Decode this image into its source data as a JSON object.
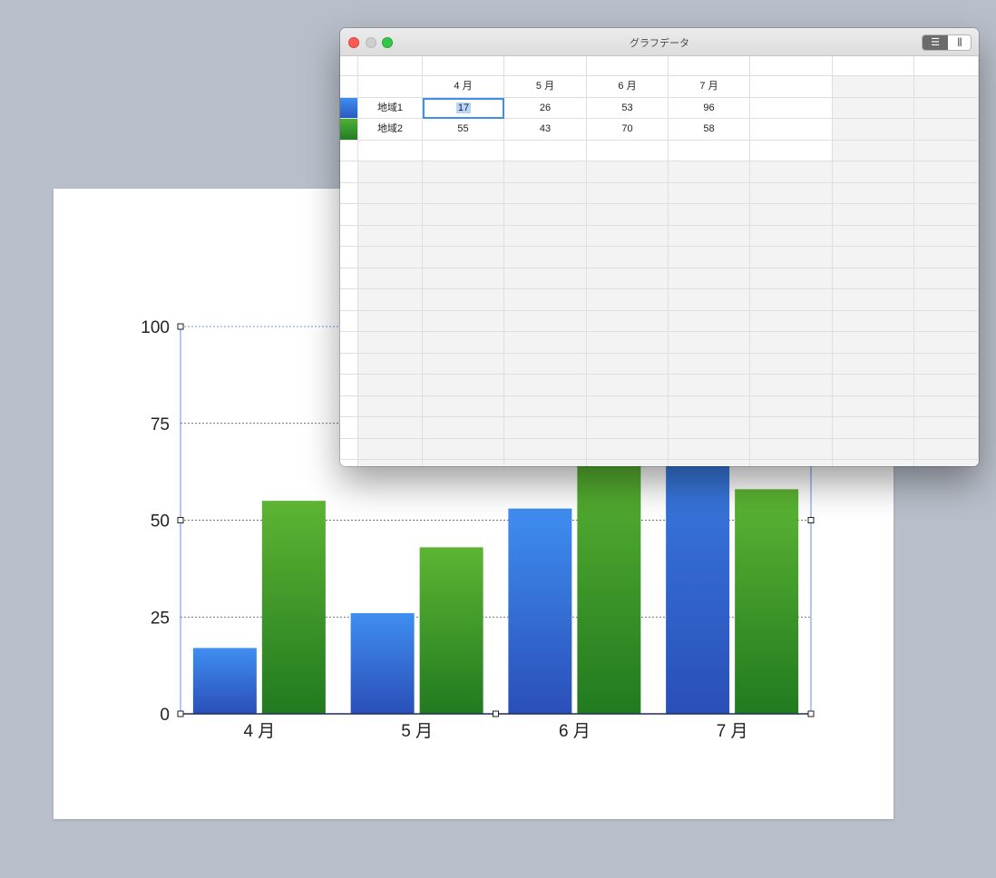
{
  "window": {
    "title": "グラフデータ",
    "view_toggle": {
      "rows_icon": "☰",
      "cols_icon": "|||",
      "selected": "rows"
    }
  },
  "table": {
    "headers": [
      "",
      "4 月",
      "5 月",
      "6 月",
      "7 月"
    ],
    "rows": [
      {
        "label": "地域1",
        "color": "#3a7be0",
        "values": [
          "17",
          "26",
          "53",
          "96"
        ]
      },
      {
        "label": "地域2",
        "color": "#2f9a2a",
        "values": [
          "55",
          "43",
          "70",
          "58"
        ]
      }
    ],
    "selected_cell": "17"
  },
  "chart_data": {
    "type": "bar",
    "categories": [
      "4 月",
      "5 月",
      "6 月",
      "7 月"
    ],
    "series": [
      {
        "name": "地域1",
        "values": [
          17,
          26,
          53,
          96
        ],
        "color_top": "#3f8ef0",
        "color_bottom": "#2a4fb8"
      },
      {
        "name": "地域2",
        "values": [
          55,
          43,
          70,
          58
        ],
        "color_top": "#5db533",
        "color_bottom": "#217a1f"
      }
    ],
    "yticks": [
      "0",
      "25",
      "50",
      "75",
      "100"
    ],
    "ylim": [
      0,
      100
    ],
    "grid": "dotted horizontal"
  }
}
